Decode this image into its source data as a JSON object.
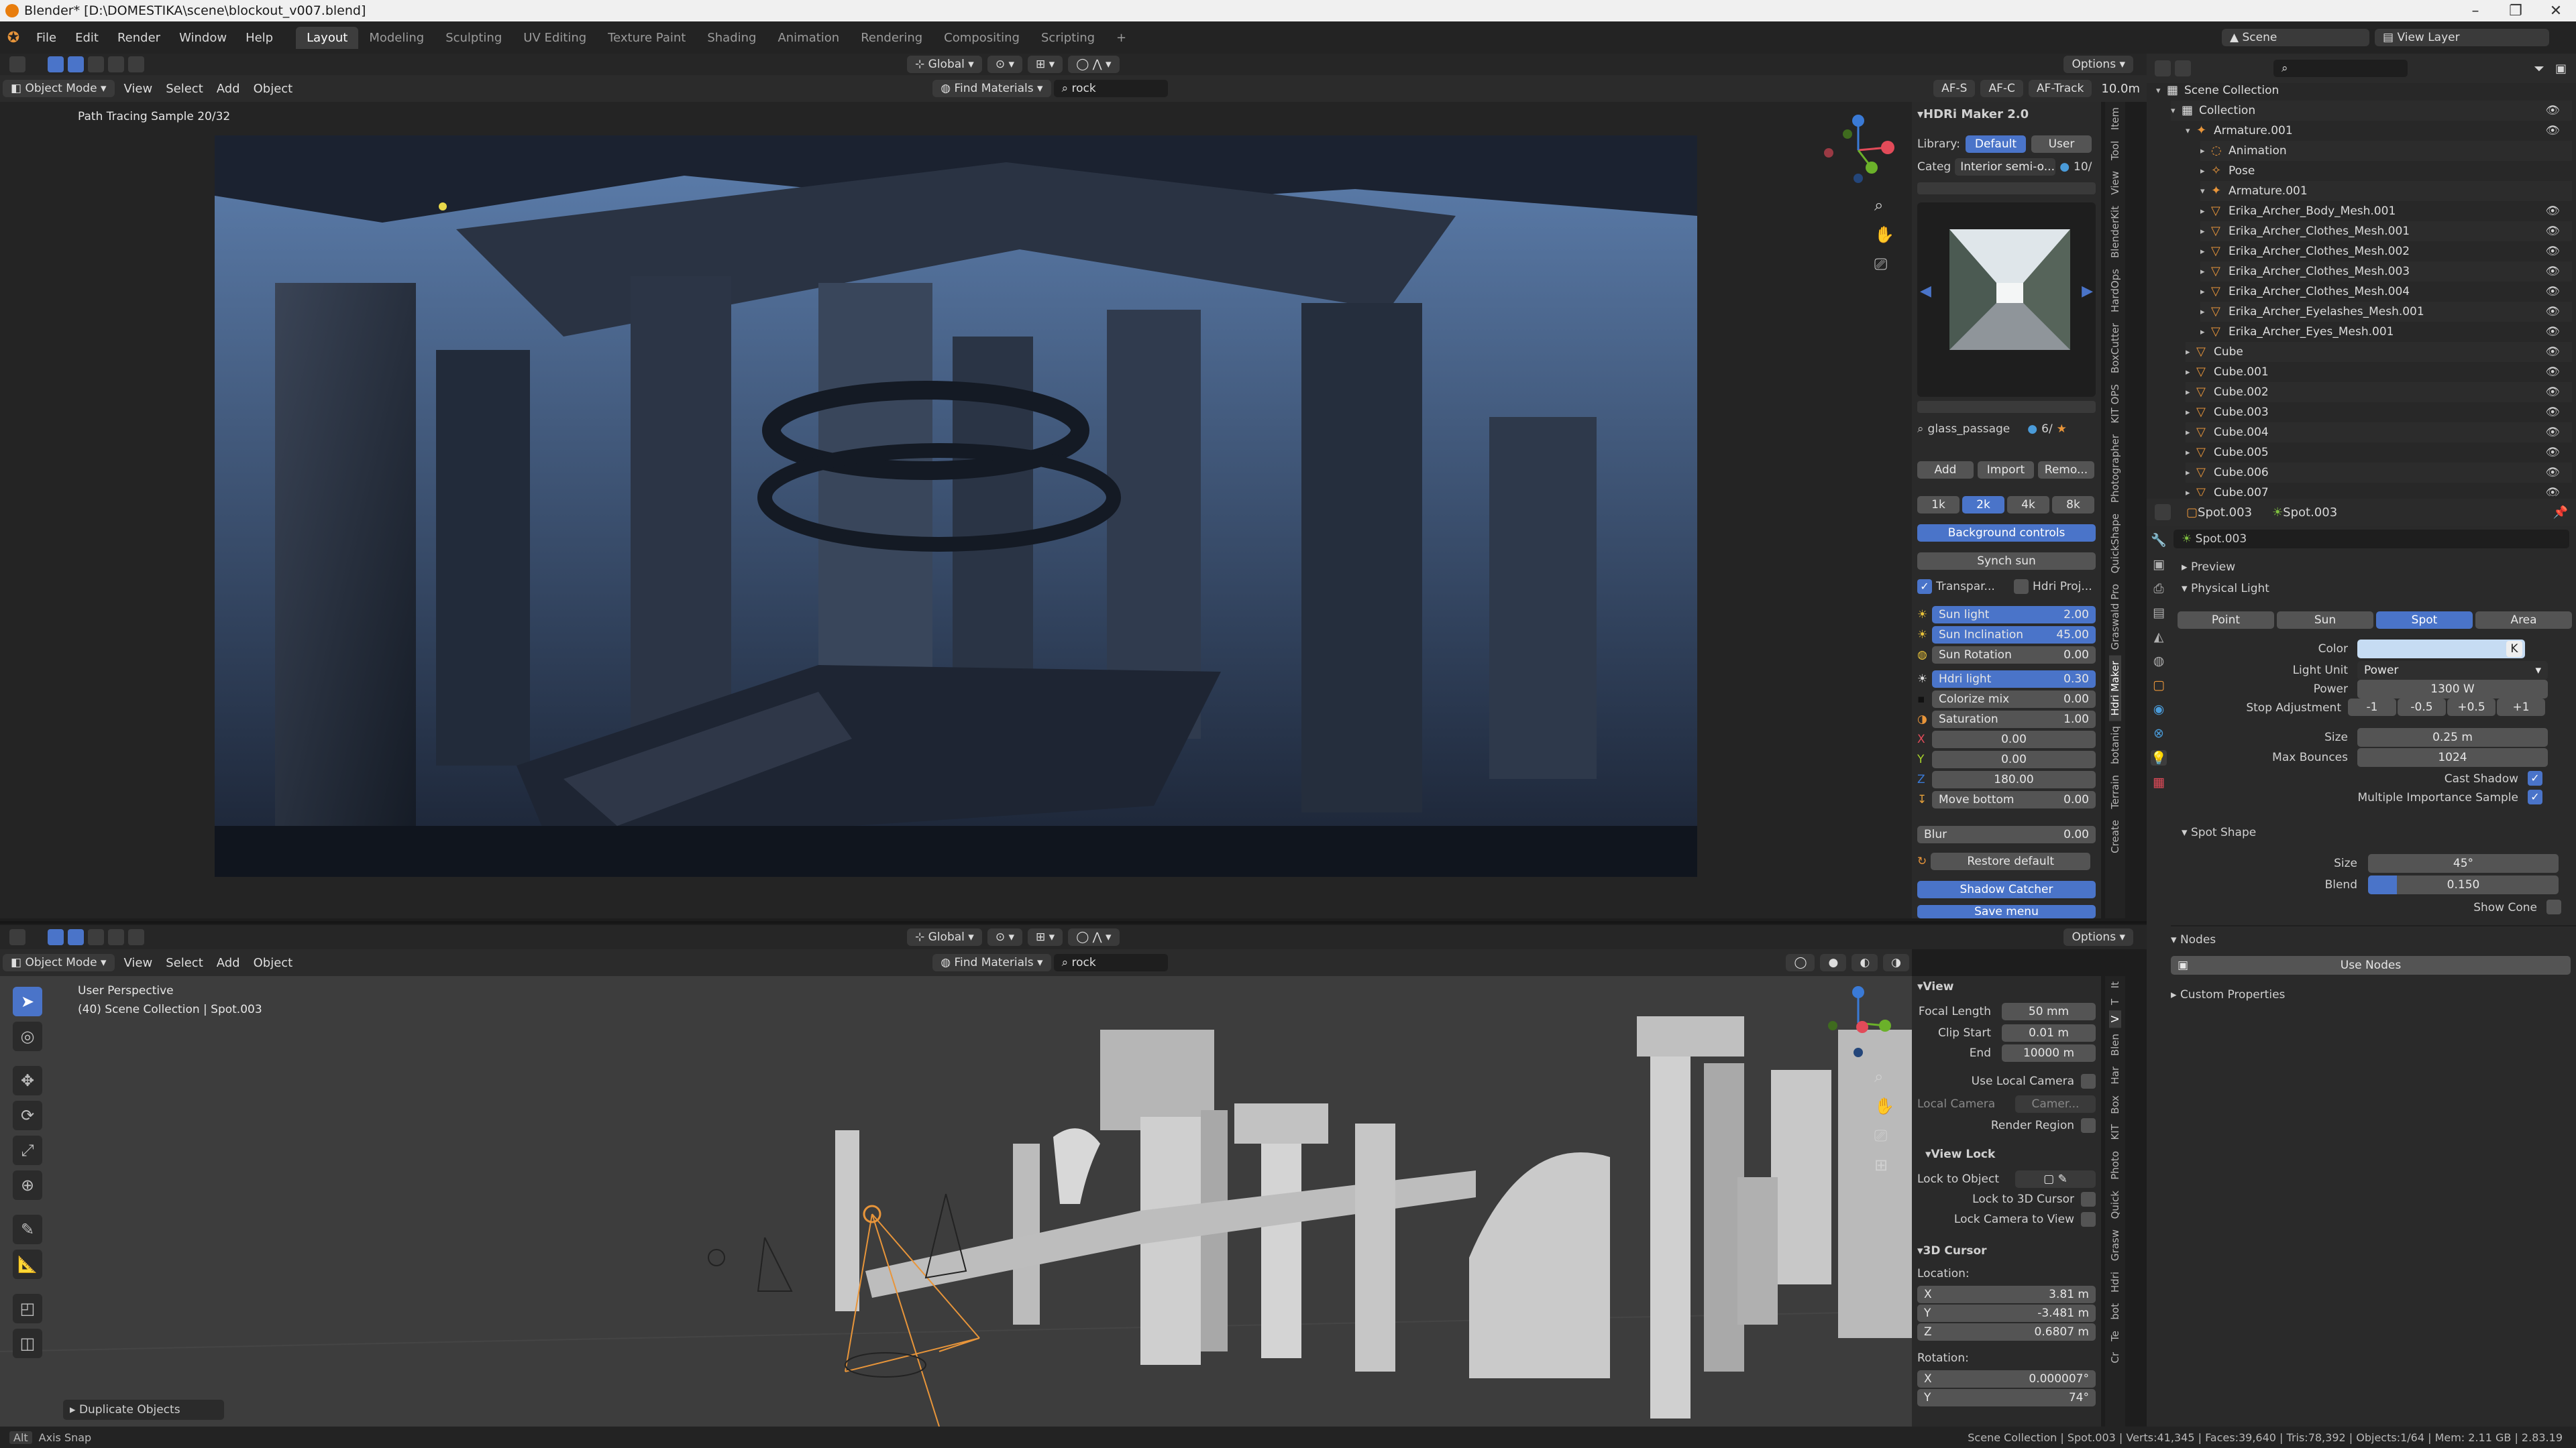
{
  "window": {
    "title": "Blender* [D:\\DOMESTIKA\\scene\\blockout_v007.blend]",
    "min": "–",
    "max": "❐",
    "close": "✕"
  },
  "menu": [
    "File",
    "Edit",
    "Render",
    "Window",
    "Help"
  ],
  "workspaces": [
    "Layout",
    "Modeling",
    "Sculpting",
    "UV Editing",
    "Texture Paint",
    "Shading",
    "Animation",
    "Rendering",
    "Compositing",
    "Scripting",
    "+"
  ],
  "scene": {
    "name": "Scene",
    "view_layer": "View Layer"
  },
  "viewport_header": {
    "mode": "Object Mode",
    "view": "View",
    "select": "Select",
    "add": "Add",
    "object": "Object",
    "orientation": "Global",
    "find_materials": "Find Materials",
    "search": "rock",
    "options": "Options",
    "af_s": "AF-S",
    "af_c": "AF-C",
    "af_track": "AF-Track",
    "distance": "10.0m"
  },
  "top_viewport": {
    "status": "Path Tracing Sample 20/32"
  },
  "bottom_viewport": {
    "title": "User Perspective",
    "subtitle": "(40) Scene Collection | Spot.003",
    "operator": "Duplicate Objects"
  },
  "hdri": {
    "title": "HDRi Maker 2.0",
    "library_label": "Library:",
    "library_default": "Default",
    "library_user": "User",
    "categ_label": "Categ",
    "categ_value": "Interior semi-o...",
    "categ_count": "10/",
    "preview_name": "glass_passage",
    "preview_count": "6/",
    "add": "Add",
    "import": "Import",
    "remove": "Remo...",
    "res": [
      "1k",
      "2k",
      "4k",
      "8k"
    ],
    "background_controls": "Background controls",
    "synch_sun": "Synch sun",
    "transparent": "Transpar...",
    "hdri_proj": "Hdri Proj...",
    "rows": [
      {
        "label": "Sun light",
        "value": "2.00",
        "hl": true
      },
      {
        "label": "Sun Inclination",
        "value": "45.00",
        "hl": true
      },
      {
        "label": "Sun Rotation",
        "value": "0.00",
        "hl": false
      },
      {
        "label": "Hdri light",
        "value": "0.30",
        "hl": true
      },
      {
        "label": "Colorize mix",
        "value": "0.00",
        "hl": false
      },
      {
        "label": "Saturation",
        "value": "1.00",
        "hl": false
      },
      {
        "label": "",
        "value": "0.00",
        "hl": false
      },
      {
        "label": "",
        "value": "0.00",
        "hl": false
      },
      {
        "label": "",
        "value": "180.00",
        "hl": false
      },
      {
        "label": "Move bottom",
        "value": "0.00",
        "hl": false
      }
    ],
    "blur_label": "Blur",
    "blur_value": "0.00",
    "restore": "Restore default",
    "shadow_catcher": "Shadow Catcher",
    "save_menu": "Save menu"
  },
  "top_tabs": [
    "Item",
    "Tool",
    "View",
    "BlenderKit",
    "HardOps",
    "BoxCutter",
    "KIT OPS",
    "Photographer",
    "QuickShape",
    "Graswald Pro",
    "Hdri Maker",
    "botaniq",
    "Terrain",
    "Create"
  ],
  "bottom_tabs": [
    "It",
    "T",
    "V",
    "Blen",
    "Har",
    "Box",
    "KIT",
    "Photo",
    "Quick",
    "Grasw",
    "Hdri",
    "bot",
    "Te",
    "Cr"
  ],
  "view_panel": {
    "view_title": "View",
    "focal_label": "Focal Length",
    "focal": "50 mm",
    "clip_start_label": "Clip Start",
    "clip_start": "0.01 m",
    "end_label": "End",
    "end": "10000 m",
    "use_local_camera": "Use Local Camera",
    "local_camera_label": "Local Camera",
    "local_camera": "Camer...",
    "render_region": "Render Region",
    "view_lock": "View Lock",
    "lock_to_object": "Lock to Object",
    "lock_3d_cursor": "Lock to 3D Cursor",
    "lock_camera": "Lock Camera to View",
    "cursor_title": "3D Cursor",
    "location_label": "Location:",
    "x": "3.81 m",
    "y": "-3.481 m",
    "z": "0.6807 m",
    "rotation_label": "Rotation:",
    "rx": "0.000007°",
    "ry": "74°"
  },
  "outliner": {
    "search": "",
    "rows": [
      {
        "name": "Scene Collection",
        "indent": 0,
        "icon": "▦",
        "eye": false
      },
      {
        "name": "Collection",
        "indent": 1,
        "icon": "▦",
        "eye": true
      },
      {
        "name": "Armature.001",
        "indent": 2,
        "icon": "✦",
        "eye": true
      },
      {
        "name": "Animation",
        "indent": 3,
        "icon": "◌",
        "eye": false
      },
      {
        "name": "Pose",
        "indent": 3,
        "icon": "✧",
        "eye": false
      },
      {
        "name": "Armature.001",
        "indent": 3,
        "icon": "✦",
        "eye": false
      },
      {
        "name": "Erika_Archer_Body_Mesh.001",
        "indent": 3,
        "icon": "▽",
        "eye": true
      },
      {
        "name": "Erika_Archer_Clothes_Mesh.001",
        "indent": 3,
        "icon": "▽",
        "eye": true
      },
      {
        "name": "Erika_Archer_Clothes_Mesh.002",
        "indent": 3,
        "icon": "▽",
        "eye": true
      },
      {
        "name": "Erika_Archer_Clothes_Mesh.003",
        "indent": 3,
        "icon": "▽",
        "eye": true
      },
      {
        "name": "Erika_Archer_Clothes_Mesh.004",
        "indent": 3,
        "icon": "▽",
        "eye": true
      },
      {
        "name": "Erika_Archer_Eyelashes_Mesh.001",
        "indent": 3,
        "icon": "▽",
        "eye": true
      },
      {
        "name": "Erika_Archer_Eyes_Mesh.001",
        "indent": 3,
        "icon": "▽",
        "eye": true
      },
      {
        "name": "Cube",
        "indent": 2,
        "icon": "▽",
        "eye": true
      },
      {
        "name": "Cube.001",
        "indent": 2,
        "icon": "▽",
        "eye": true
      },
      {
        "name": "Cube.002",
        "indent": 2,
        "icon": "▽",
        "eye": true
      },
      {
        "name": "Cube.003",
        "indent": 2,
        "icon": "▽",
        "eye": true
      },
      {
        "name": "Cube.004",
        "indent": 2,
        "icon": "▽",
        "eye": true
      },
      {
        "name": "Cube.005",
        "indent": 2,
        "icon": "▽",
        "eye": true
      },
      {
        "name": "Cube.006",
        "indent": 2,
        "icon": "▽",
        "eye": true
      },
      {
        "name": "Cube.007",
        "indent": 2,
        "icon": "▽",
        "eye": true
      }
    ]
  },
  "properties": {
    "breadcrumb_a": "Spot.003",
    "breadcrumb_b": "Spot.003",
    "data_name": "Spot.003",
    "preview": "Preview",
    "physical_light": "Physical Light",
    "types": [
      "Point",
      "Sun",
      "Spot",
      "Area"
    ],
    "color_label": "Color",
    "color_hex": "#c6dcf3",
    "color_k": "K",
    "light_unit_label": "Light Unit",
    "light_unit": "Power",
    "power_label": "Power",
    "power": "1300 W",
    "stop_label": "Stop Adjustment",
    "stops": [
      "-1",
      "-0.5",
      "+0.5",
      "+1"
    ],
    "size_label": "Size",
    "size": "0.25 m",
    "bounces_label": "Max Bounces",
    "bounces": "1024",
    "cast_shadow": "Cast Shadow",
    "mis": "Multiple Importance Sample",
    "spot_shape": "Spot Shape",
    "spot_size_label": "Size",
    "spot_size": "45°",
    "blend_label": "Blend",
    "blend": "0.150",
    "blend_fraction": 0.15,
    "show_cone": "Show Cone",
    "nodes": "Nodes",
    "use_nodes": "Use Nodes",
    "custom_props": "Custom Properties"
  },
  "statusbar": {
    "left": "Axis Snap",
    "right": "Scene Collection | Spot.003 | Verts:41,345 | Faces:39,640 | Tris:78,392 | Objects:1/64 | Mem: 2.11 GB | 2.83.19"
  },
  "colors": {
    "accent": "#4a74c9",
    "brand": "#e8253a",
    "orange": "#e8953a"
  }
}
